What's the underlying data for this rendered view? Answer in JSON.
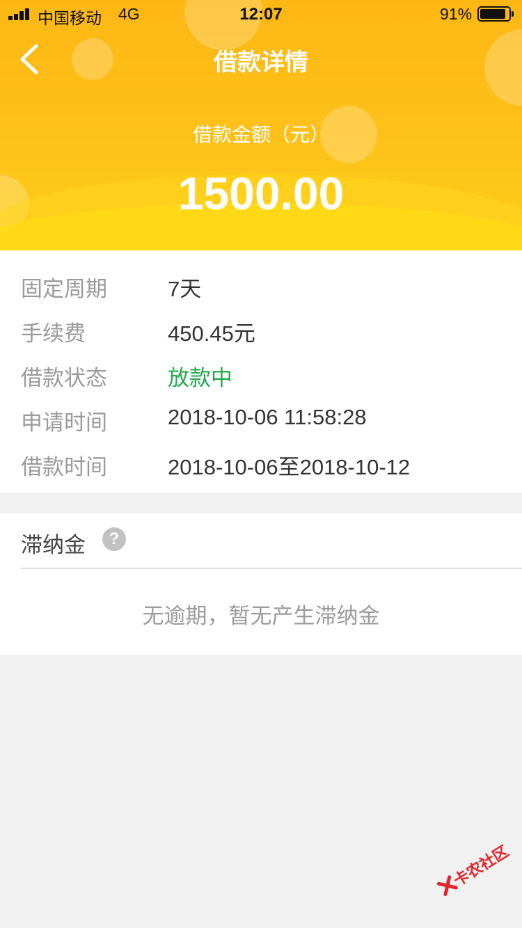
{
  "status_bar": {
    "carrier": "中国移动",
    "network": "4G",
    "time": "12:07",
    "battery": "91%",
    "battery_level": 0.91
  },
  "header": {
    "title": "借款详情",
    "back_icon": "chevron-left-icon",
    "amount_label": "借款金额（元）",
    "amount": "1500.00"
  },
  "details": [
    {
      "label": "固定周期",
      "value": "7天"
    },
    {
      "label": "手续费",
      "value": "450.45元"
    },
    {
      "label": "借款状态",
      "value": "放款中"
    },
    {
      "label": "申请时间",
      "value": "2018-10-06 11:58:28"
    },
    {
      "label": "借款时间",
      "value": "2018-10-06至2018-10-12"
    }
  ],
  "late_fee": {
    "title": "滞纳金",
    "help_icon": "question-mark-icon",
    "help_glyph": "?",
    "message": "无逾期，暂无产生滞纳金"
  },
  "watermark": {
    "text": "卡农社区"
  },
  "colors": {
    "header_yellow": "#fec21a",
    "status_green": "#23a84a",
    "label_gray": "#9a9a9a",
    "value_dark": "#333333",
    "watermark_red": "#e1252b"
  }
}
